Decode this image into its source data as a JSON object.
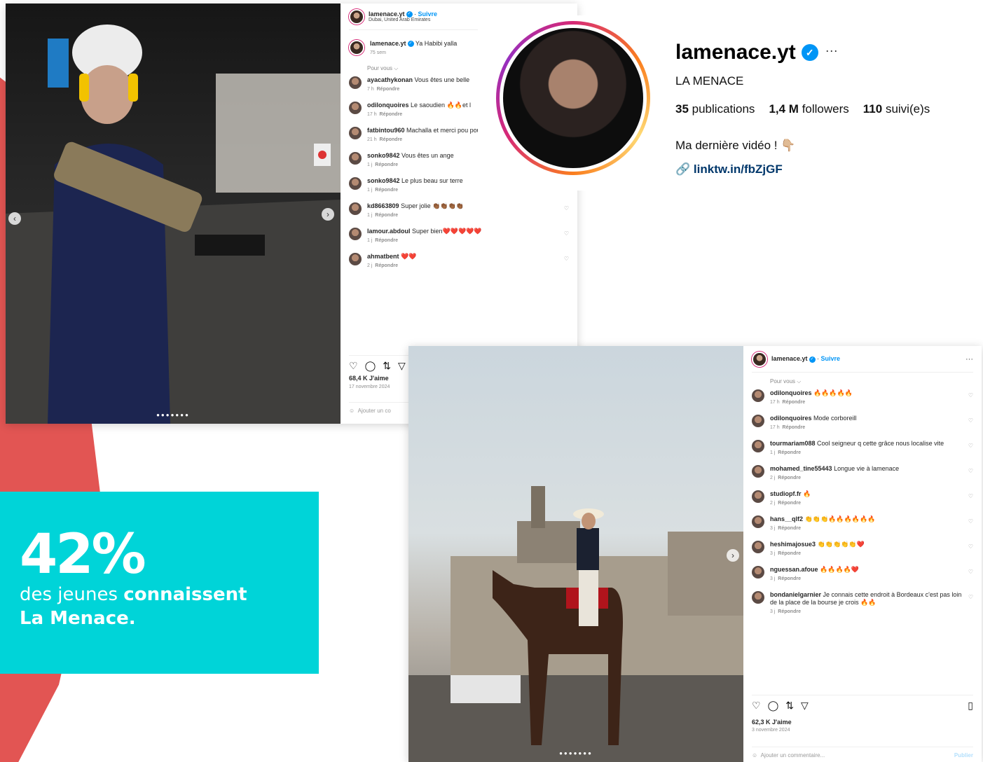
{
  "stat": {
    "number": "42%",
    "line1_a": "des jeunes ",
    "line1_b": "connaissent",
    "line2": "La Menace."
  },
  "profile": {
    "username": "lamenace.yt",
    "verified_mark": "✓",
    "more": "···",
    "full_name": "LA MENACE",
    "publications_count": "35",
    "publications_label": " publications",
    "followers_count": "1,4 M",
    "followers_label": " followers",
    "following_count": "110",
    "following_label": " suivi(e)s",
    "bio": "Ma dernière vidéo ! 👇🏼",
    "link_icon": "🔗",
    "link": "linktw.in/fbZjGF"
  },
  "post1": {
    "username": "lamenace.yt",
    "follow": "Suivre",
    "location": "Dubai, United Arab Emirates",
    "caption_user": "lamenace.yt",
    "caption": "Ya Habibi yalla",
    "caption_time": "75 sem",
    "section": "Pour vous ⌵",
    "comments": [
      {
        "user": "ayacathykonan",
        "text": "Vous êtes une belle",
        "time": "7 h",
        "reply": "Répondre"
      },
      {
        "user": "odilonquoires",
        "text": "Le saoudien 🔥🔥et l",
        "time": "17 h",
        "reply": "Répondre"
      },
      {
        "user": "fatbintou960",
        "text": "Machalla et merci pou pour les gens",
        "time": "21 h",
        "reply": "Répondre"
      },
      {
        "user": "sonko9842",
        "text": "Vous êtes un ange",
        "time": "1 j",
        "reply": "Répondre"
      },
      {
        "user": "sonko9842",
        "text": "Le plus beau sur terre",
        "time": "1 j",
        "reply": "Répondre"
      },
      {
        "user": "kd8663809",
        "text": "Super jolie 👏🏾👏🏾👏🏾👏🏾",
        "time": "1 j",
        "reply": "Répondre"
      },
      {
        "user": "lamour.abdoul",
        "text": "Super bien❤️❤️❤️❤️❤️",
        "time": "1 j",
        "reply": "Répondre"
      },
      {
        "user": "ahmatbent",
        "text": "❤️❤️",
        "time": "2 j",
        "reply": "Répondre"
      }
    ],
    "likes": "68,4 K J'aime",
    "date": "17 novembre 2024",
    "add_comment": "Ajouter un co"
  },
  "post2": {
    "username": "lamenace.yt",
    "follow": "Suivre",
    "more": "···",
    "section": "Pour vous ⌵",
    "comments": [
      {
        "user": "odilonquoires",
        "text": "🔥🔥🔥🔥🔥",
        "time": "17 h",
        "reply": "Répondre"
      },
      {
        "user": "odilonquoires",
        "text": "Mode corboreill",
        "time": "17 h",
        "reply": "Répondre"
      },
      {
        "user": "tourmariam088",
        "text": "Cool seigneur q cette grâce nous localise vite",
        "time": "1 j",
        "reply": "Répondre"
      },
      {
        "user": "mohamed_tine55443",
        "text": "Longue vie à lamenace",
        "time": "2 j",
        "reply": "Répondre"
      },
      {
        "user": "studiopf.fr",
        "text": "🔥",
        "time": "2 j",
        "reply": "Répondre"
      },
      {
        "user": "hans__qlf2",
        "text": "👏👏👏🔥🔥🔥🔥🔥🔥",
        "time": "3 j",
        "reply": "Répondre"
      },
      {
        "user": "heshimajosue3",
        "text": "👏👏👏👏👏❤️",
        "time": "3 j",
        "reply": "Répondre"
      },
      {
        "user": "nguessan.afoue",
        "text": "🔥🔥🔥🔥❤️",
        "time": "3 j",
        "reply": "Répondre"
      },
      {
        "user": "bondanielgarnier",
        "text": "Je connais cette endroit à Bordeaux c'est pas loin de la place de la bourse je crois 🔥🔥",
        "time": "3 j",
        "reply": "Répondre"
      }
    ],
    "likes": "62,3 K J'aime",
    "date": "3 novembre 2024",
    "add_comment": "Ajouter un commentaire...",
    "publish": "Publier"
  }
}
